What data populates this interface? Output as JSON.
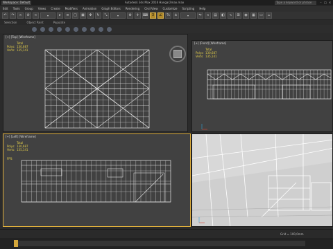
{
  "titlebar": {
    "workspace": "Workspace: Default",
    "title": "Autodesk 3ds Max 2016    Hangar2max.max",
    "search_placeholder": "Type a keyword or phrase"
  },
  "menu": [
    "Edit",
    "Tools",
    "Group",
    "Views",
    "Create",
    "Modifiers",
    "Animation",
    "Graph Editors",
    "Rendering",
    "Civil View",
    "Customize",
    "Scripting",
    "Help"
  ],
  "ribbon": [
    "Selection",
    "Object Paint",
    "Populate"
  ],
  "viewports": {
    "top": {
      "label": "[+] [Top] [Wireframe]",
      "total": "Total",
      "polys_label": "Polys:",
      "polys": "130,687",
      "verts_label": "Verts:",
      "verts": "135,141"
    },
    "front": {
      "label": "[+] [Front] [Wireframe]",
      "total": "Total",
      "polys_label": "Polys:",
      "polys": "130,687",
      "verts_label": "Verts:",
      "verts": "135,141"
    },
    "left": {
      "label": "[+] [Left] [Wireframe]",
      "total": "Total",
      "polys_label": "Polys:",
      "polys": "130,687",
      "verts_label": "Verts:",
      "verts": "135,141",
      "fps": "FPS:"
    },
    "perspective": {
      "label": ""
    }
  },
  "status": {
    "grid": "Grid = 100,0mm"
  },
  "colors": {
    "active_border": "#e2b13c",
    "stats_text": "#e6d04a",
    "viewport_bg": "#414141",
    "wire": "#d9d9d9"
  }
}
